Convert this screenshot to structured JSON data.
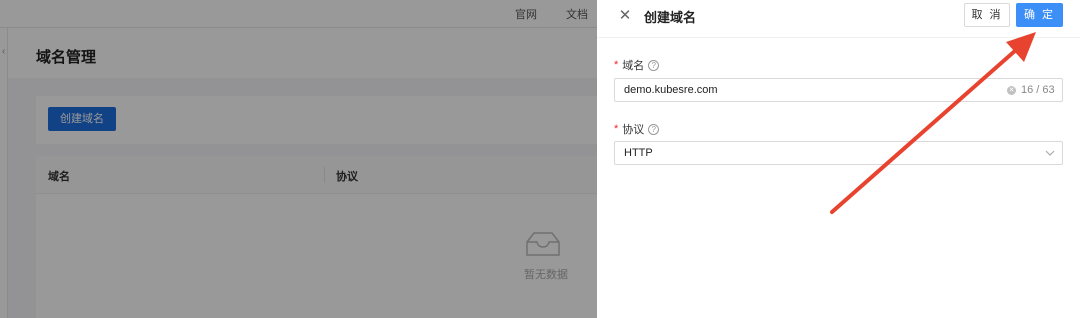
{
  "top_nav": {
    "links": [
      "官网",
      "文档"
    ]
  },
  "page": {
    "title": "域名管理",
    "create_button": "创建域名",
    "table": {
      "columns": [
        "域名",
        "协议"
      ],
      "empty_text": "暂无数据"
    }
  },
  "drawer": {
    "title": "创建域名",
    "cancel_label": "取 消",
    "ok_label": "确 定",
    "fields": {
      "domain": {
        "label": "域名",
        "value": "demo.kubesre.com",
        "count": "16 / 63"
      },
      "protocol": {
        "label": "协议",
        "value": "HTTP"
      }
    }
  },
  "icons": [
    "close-icon",
    "help-icon",
    "clear-icon",
    "chevron-down-icon",
    "empty-box-icon",
    "collapse-icon"
  ],
  "colors": {
    "primary": "#3d8ff8",
    "danger": "#f5222d",
    "annotation_arrow": "#e8432f"
  }
}
